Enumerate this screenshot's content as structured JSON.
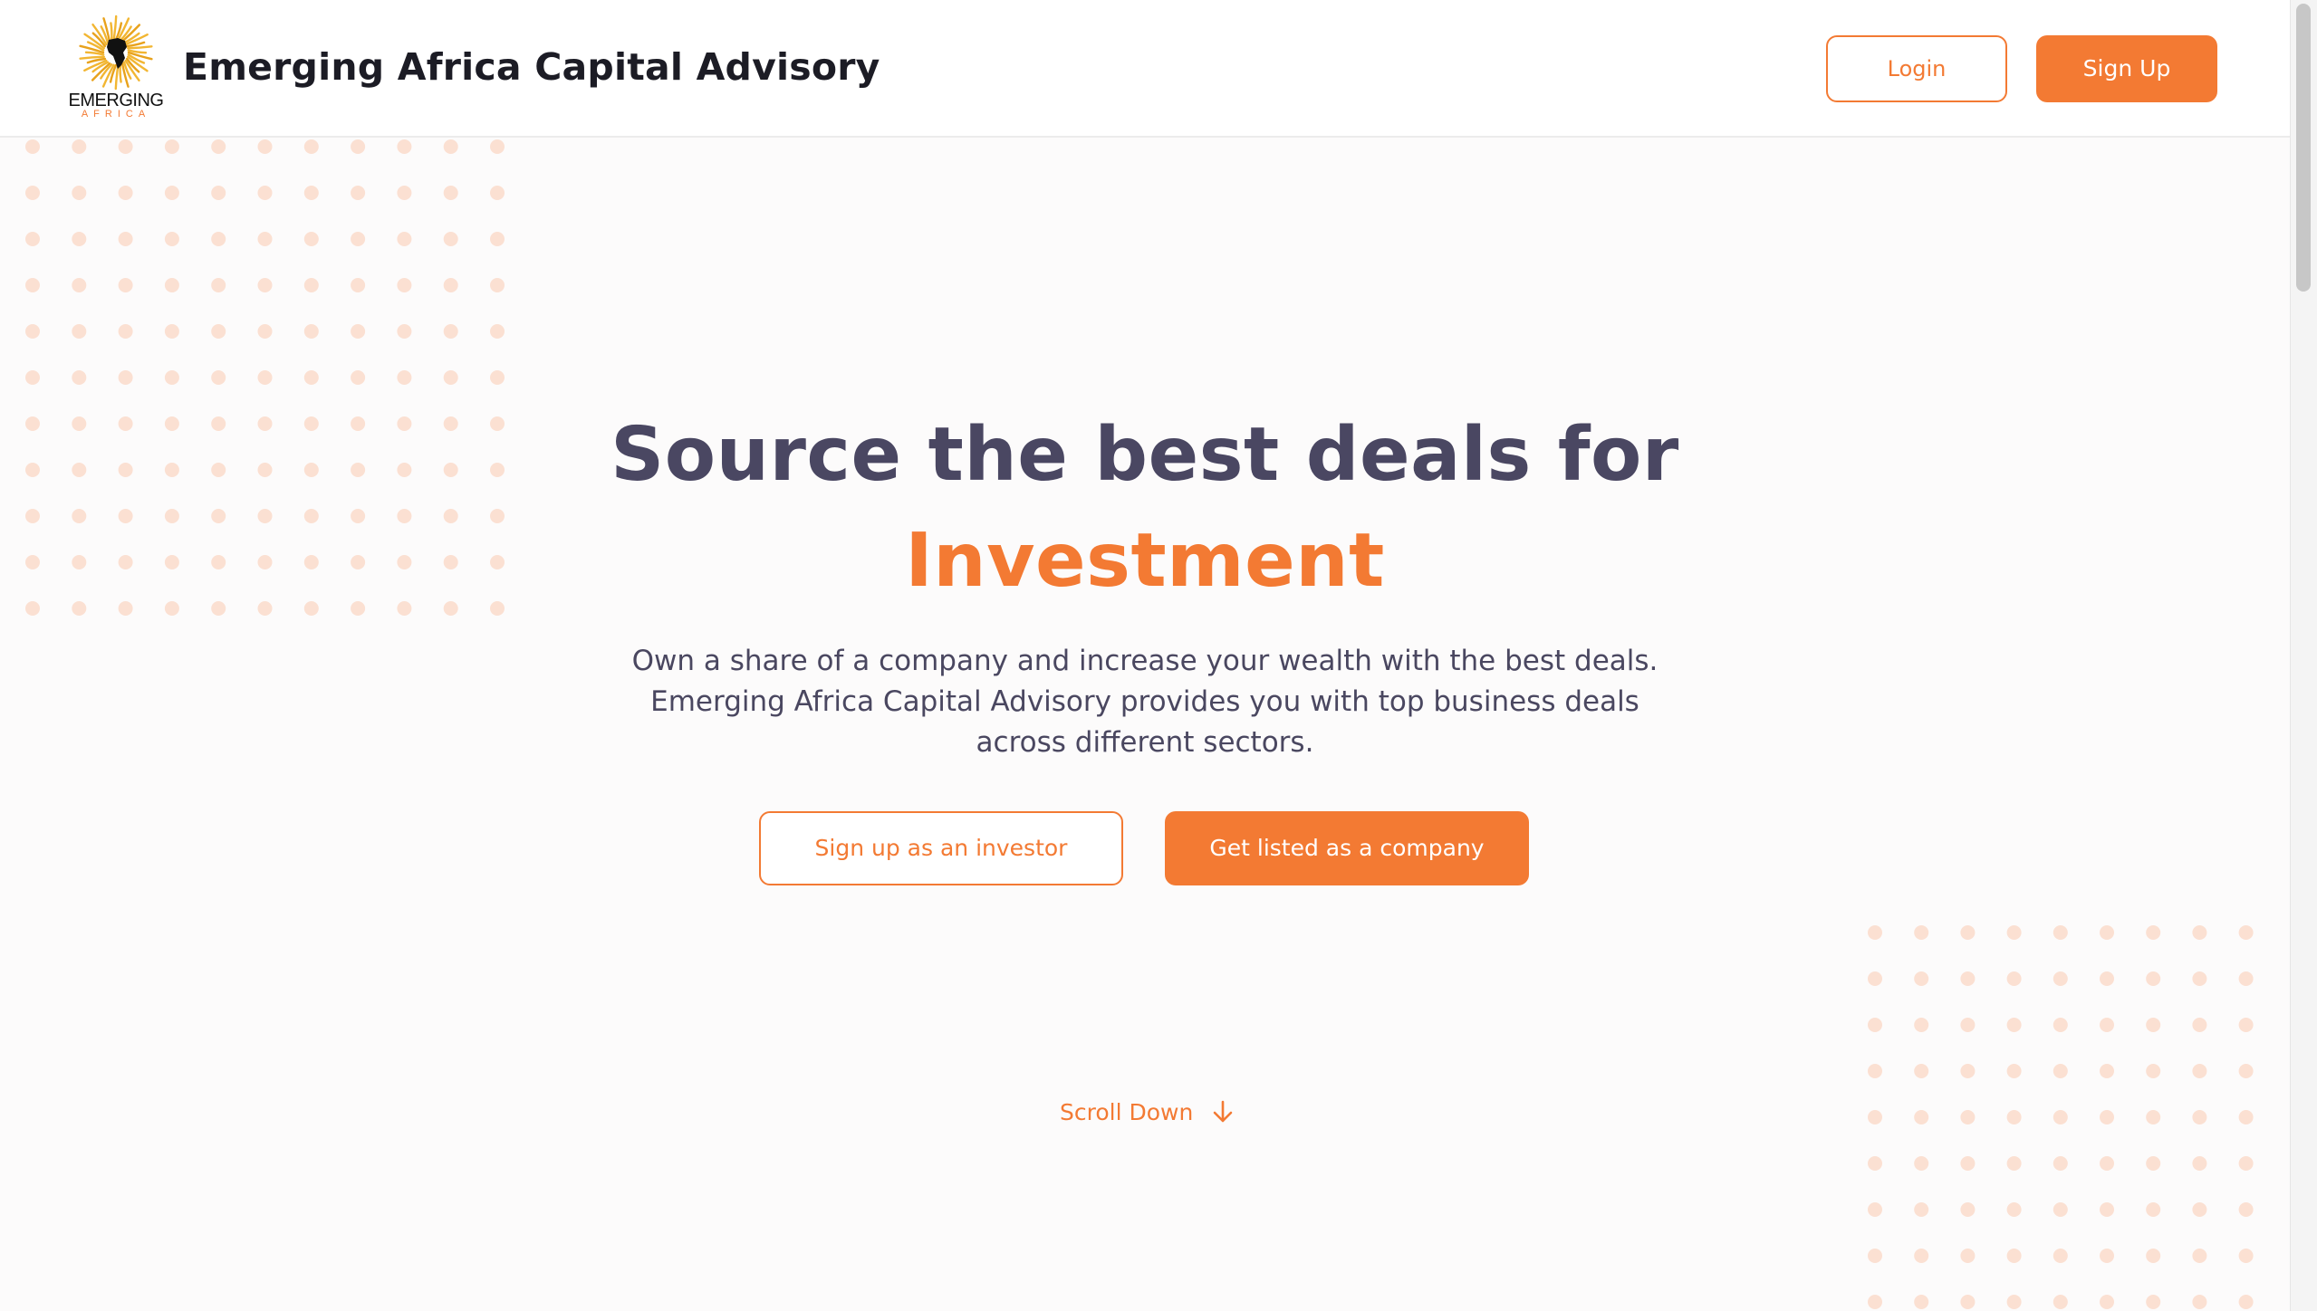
{
  "header": {
    "logo_text_top": "EMERGING",
    "logo_text_bottom": "AFRICA",
    "brand_title": "Emerging Africa Capital Advisory",
    "login_label": "Login",
    "signup_label": "Sign Up"
  },
  "hero": {
    "headline_line1": "Source the best deals for",
    "headline_line2": "Investment",
    "description_lines": [
      "Own a share of a company and increase your wealth with the best deals.",
      "Emerging Africa Capital Advisory provides you with top business deals",
      "across different sectors."
    ],
    "investor_button_label": "Sign up as an investor",
    "company_button_label": "Get listed as a company",
    "scroll_down_label": "Scroll Down"
  },
  "icons": {
    "logo": "sunburst-africa-logo",
    "scroll_down": "arrow-down-icon"
  },
  "colors": {
    "accent": "#f37a33",
    "heading": "#4a4762",
    "text": "#4a4760",
    "brand_title": "#1c1c25",
    "dots": "#fbe0d2",
    "background": "#fcfbfb"
  }
}
